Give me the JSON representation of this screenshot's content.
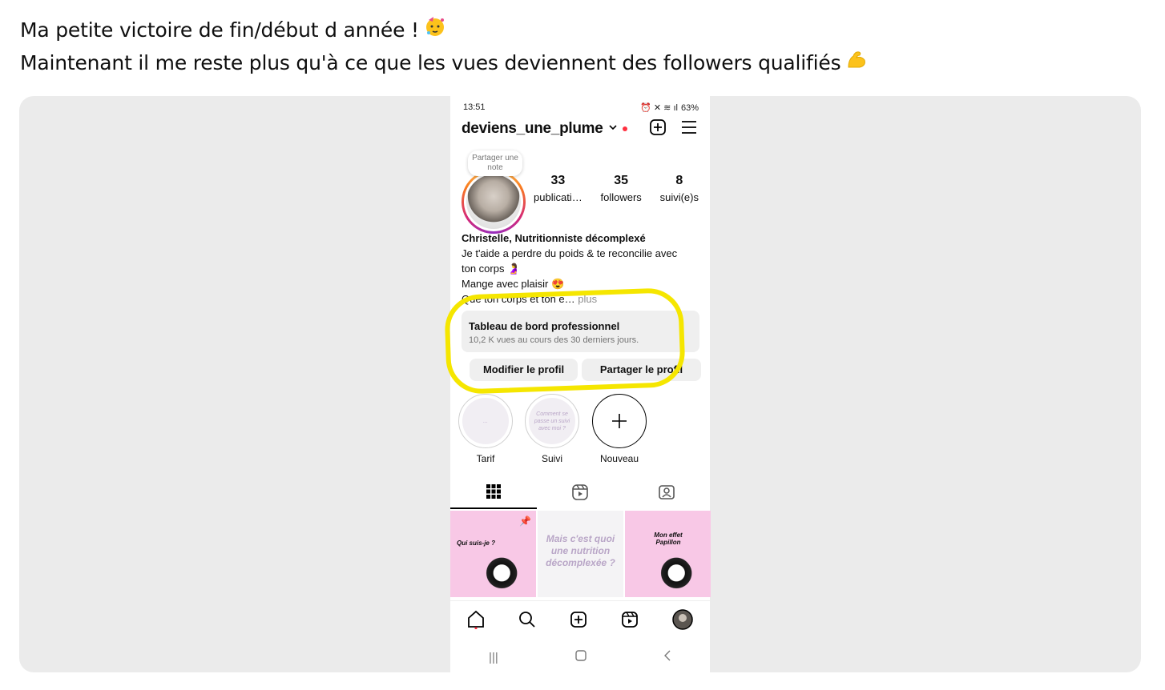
{
  "post": {
    "line1": "Ma petite victoire de fin/début d année !",
    "line2": "Maintenant il me reste plus qu'à ce que les vues deviennent des followers qualifiés"
  },
  "phone": {
    "status": {
      "time": "13:51",
      "battery": "63%"
    },
    "username": "deviens_une_plume",
    "note_label": "Partager une note",
    "stats": [
      {
        "value": "33",
        "label": "publicati…"
      },
      {
        "value": "35",
        "label": "followers"
      },
      {
        "value": "8",
        "label": "suivi(e)s"
      }
    ],
    "bio": {
      "name": "Christelle, Nutritionniste décomplexé",
      "line1": "Je t'aide a perdre du poids & te reconcilie avec",
      "line2": "ton corps",
      "line3": "Mange avec plaisir",
      "line4": "Que ton corps et ton e…",
      "more": "plus"
    },
    "dashboard": {
      "title": "Tableau de bord professionnel",
      "subtitle": "10,2 K vues au cours des 30 derniers jours."
    },
    "buttons": {
      "edit": "Modifier le profil",
      "share": "Partager le profil"
    },
    "highlights": [
      {
        "label": "Tarif",
        "inner": "..."
      },
      {
        "label": "Suivi",
        "inner": "Comment se passe un suivi avec moi ?"
      },
      {
        "label": "Nouveau"
      }
    ],
    "grid": [
      {
        "caption": "Qui suis-je ?"
      },
      {
        "caption": "Mais c'est quoi une nutrition décomplexée ?"
      },
      {
        "caption": "Mon effet Papillon"
      }
    ],
    "accent_colors": {
      "highlight": "#f5e600",
      "pink": "#f8c8e6",
      "notif": "#ff3040"
    }
  }
}
